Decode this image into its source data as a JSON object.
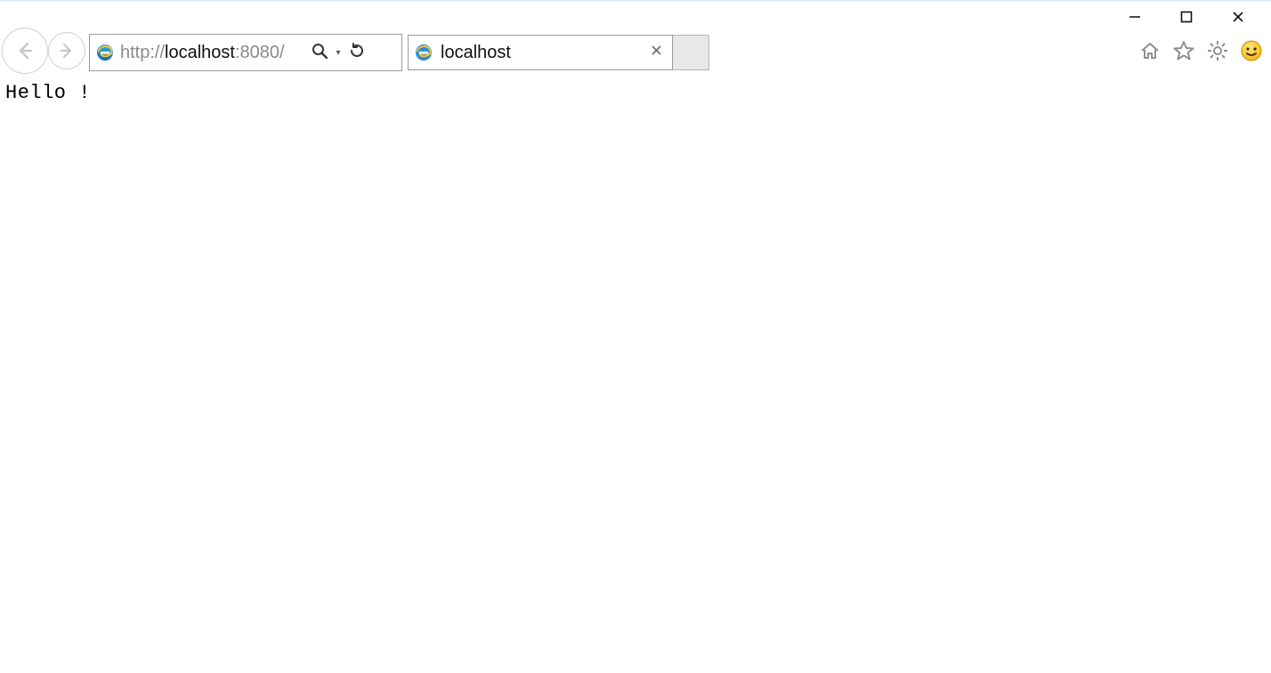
{
  "address_bar": {
    "url_prefix": "http://",
    "url_host": "localhost",
    "url_suffix": ":8080/"
  },
  "tab": {
    "title": "localhost"
  },
  "page": {
    "body_text": "Hello !"
  }
}
